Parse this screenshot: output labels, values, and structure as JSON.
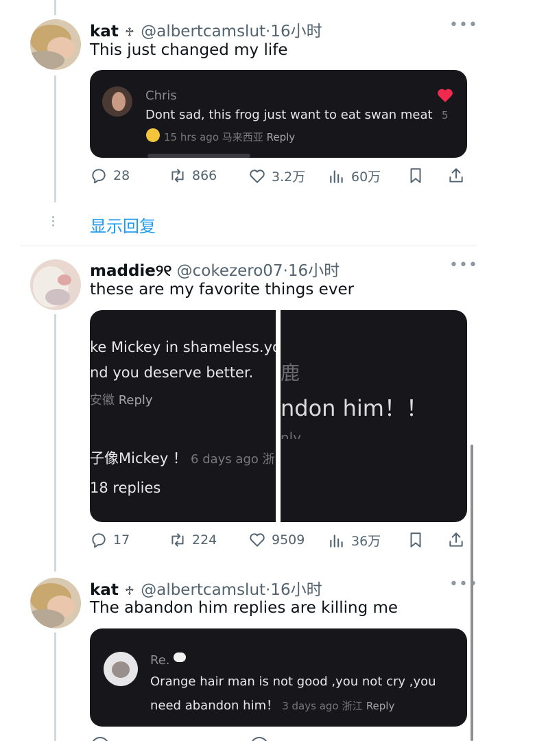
{
  "posts": [
    {
      "name": "kat",
      "glyph": "♱",
      "handle": "@albertcamslut",
      "time": "16小时",
      "text": "This just changed my life",
      "comment": {
        "author": "Chris",
        "text": "Dont sad, this frog just want to eat swan meat",
        "time": "15 hrs ago",
        "location": "马来西亚",
        "reply": "Reply",
        "likes": "5"
      },
      "actions": {
        "replies": "28",
        "reposts": "866",
        "likes": "3.2万",
        "views": "60万"
      }
    },
    {
      "name": "maddie୨୧",
      "handle": "@cokezero07",
      "time": "16小时",
      "text": "these are my favorite things ever",
      "left_panel": {
        "line1": "ke Mickey in shameless.yo",
        "line2": "nd you deserve better.",
        "meta_loc": "安徽",
        "meta_reply": "Reply",
        "line3": "子像Mickey ！",
        "line3_meta": "6 days ago 浙江",
        "replies": "18 replies"
      },
      "right_panel": {
        "top_char": "鹿",
        "big": "ndon him！！",
        "bottom": "nly"
      },
      "actions": {
        "replies": "17",
        "reposts": "224",
        "likes": "9509",
        "views": "36万"
      }
    },
    {
      "name": "kat",
      "glyph": "♱",
      "handle": "@albertcamslut",
      "time": "16小时",
      "text": "The abandon him replies are killing me",
      "comment": {
        "author": "Re.",
        "text1": "Orange hair man is not good ,you not cry ,you",
        "text2": "need abandon him！",
        "time": "3 days ago",
        "location": "浙江",
        "reply": "Reply"
      }
    }
  ],
  "show_replies": "显示回复",
  "colors": {
    "accent": "#1d9bf0",
    "heart": "#f0294e",
    "card_bg": "#17171b"
  }
}
